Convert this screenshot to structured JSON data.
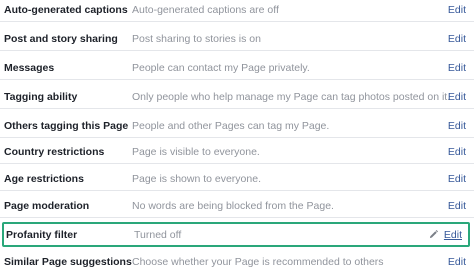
{
  "settings": {
    "edit_label": "Edit",
    "rows": [
      {
        "label": "Auto-generated captions",
        "value": "Auto-generated captions are off"
      },
      {
        "label": "Post and story sharing",
        "value": "Post sharing to stories is on"
      },
      {
        "label": "Messages",
        "value": "People can contact my Page privately."
      },
      {
        "label": "Tagging ability",
        "value": "Only people who help manage my Page can tag photos posted on it."
      },
      {
        "label": "Others tagging this Page",
        "value": "People and other Pages can tag my Page."
      },
      {
        "label": "Country restrictions",
        "value": "Page is visible to everyone."
      },
      {
        "label": "Age restrictions",
        "value": "Page is shown to everyone."
      },
      {
        "label": "Page moderation",
        "value": "No words are being blocked from the Page."
      },
      {
        "label": "Profanity filter",
        "value": "Turned off"
      },
      {
        "label": "Similar Page suggestions",
        "value": "Choose whether your Page is recommended to others"
      }
    ],
    "highlight_color": "#2aa77a",
    "link_color": "#365899"
  }
}
